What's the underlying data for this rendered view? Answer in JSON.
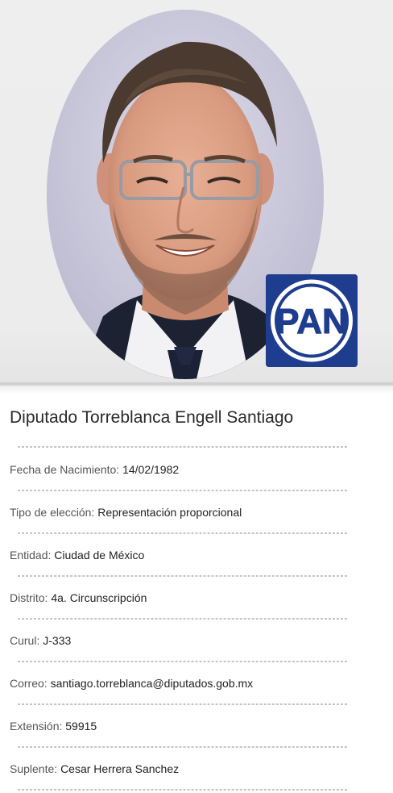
{
  "profile": {
    "title": "Diputado Torreblanca Engell Santiago",
    "party_logo_text": "PAN",
    "fields": [
      {
        "label": "Fecha de Nacimiento:",
        "value": "14/02/1982"
      },
      {
        "label": "Tipo de elección:",
        "value": "Representación proporcional"
      },
      {
        "label": "Entidad:",
        "value": "Ciudad de México"
      },
      {
        "label": "Distrito:",
        "value": "4a. Circunscripción"
      },
      {
        "label": "Curul:",
        "value": "J-333"
      },
      {
        "label": "Correo:",
        "value": "santiago.torreblanca@diputados.gob.mx"
      },
      {
        "label": "Extensión:",
        "value": "59915"
      },
      {
        "label": "Suplente:",
        "value": "Cesar Herrera Sanchez"
      }
    ]
  },
  "colors": {
    "party_blue": "#1f3d8f",
    "photo_background": "#eeeeee",
    "text": "#2a2a2a",
    "label": "#555555",
    "divider": "#c4c4c4"
  },
  "icons": {
    "portrait": "deputy-portrait-photo",
    "party_logo": "pan-party-logo"
  }
}
